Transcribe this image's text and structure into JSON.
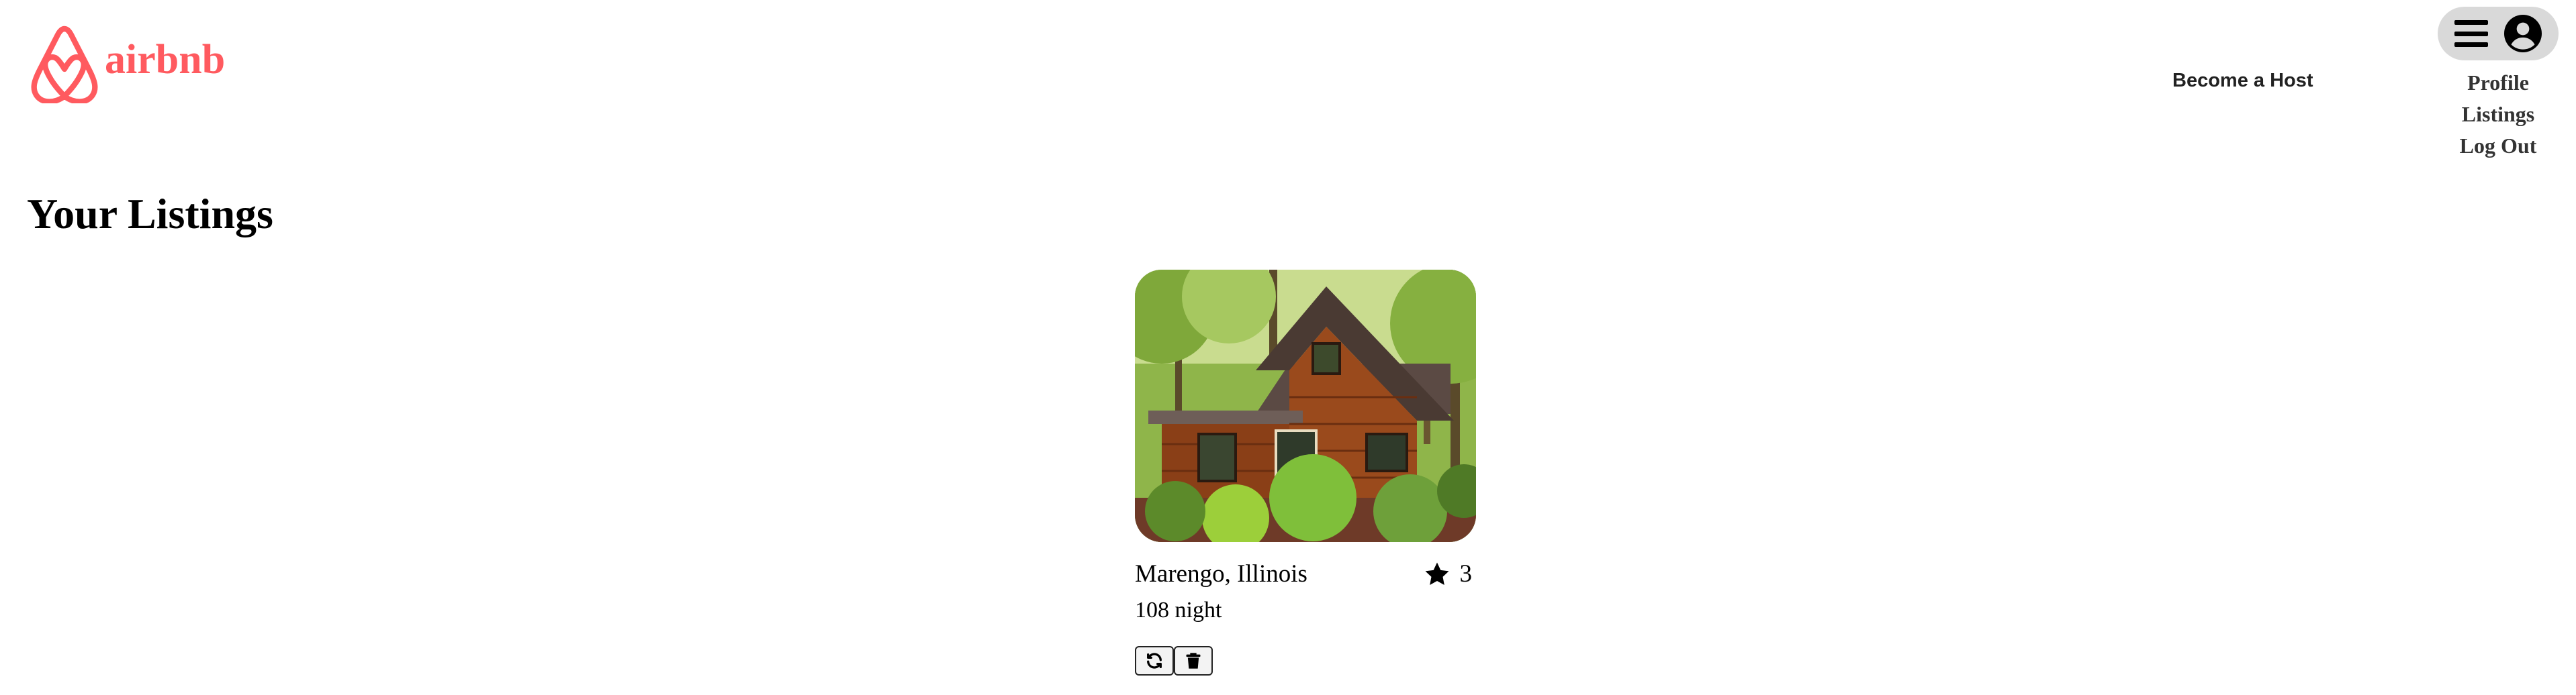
{
  "brand": {
    "name": "airbnb",
    "color": "#FF5A5F",
    "logo_icon": "airbnb-logo-icon"
  },
  "header": {
    "become_host": "Become a Host",
    "menu_icons": [
      "hamburger-icon",
      "user-circle-icon"
    ],
    "dropdown": [
      {
        "label": "Profile"
      },
      {
        "label": "Listings"
      },
      {
        "label": "Log Out"
      }
    ]
  },
  "main": {
    "title": "Your Listings",
    "listings": [
      {
        "location": "Marengo, Illinois",
        "rating": "3",
        "price": "108 night",
        "image": "log-cabin-photo",
        "actions": [
          "refresh-icon",
          "trash-icon"
        ]
      }
    ]
  }
}
